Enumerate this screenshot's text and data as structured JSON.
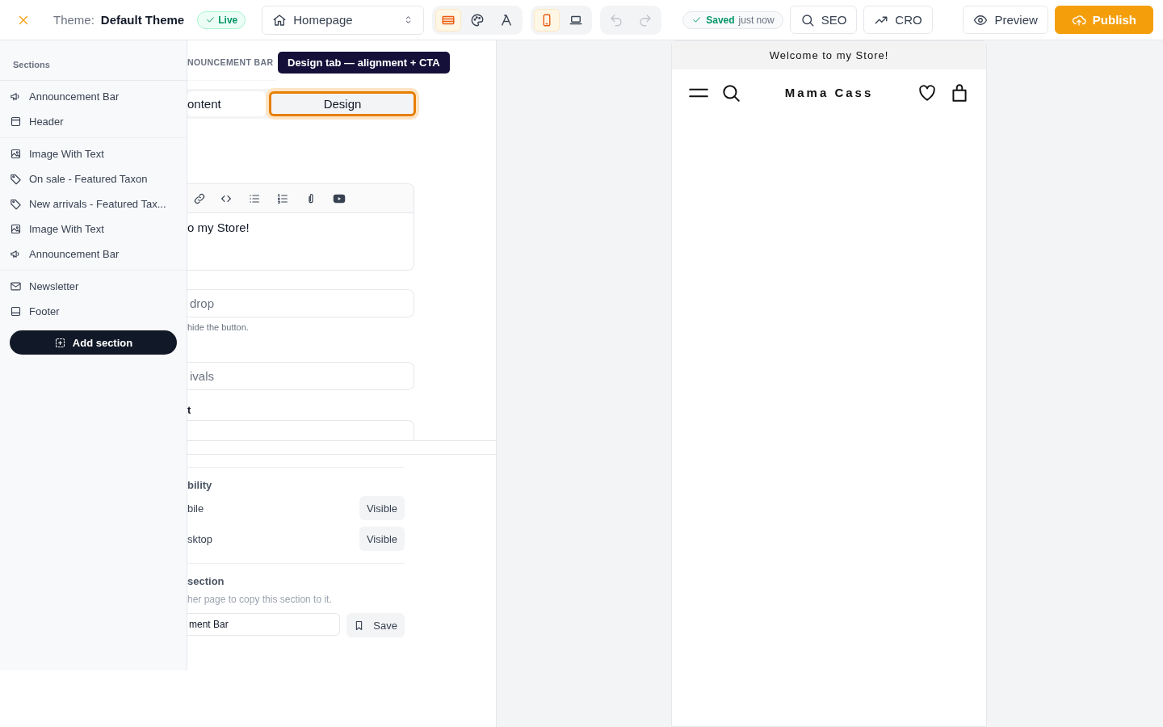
{
  "topbar": {
    "theme_label": "Theme:",
    "theme_name": "Default Theme",
    "status_badge": "Live",
    "page_select": "Homepage",
    "view_modes": [
      {
        "kind": "sections",
        "selected": true
      },
      {
        "kind": "palette",
        "selected": false
      },
      {
        "kind": "typography",
        "selected": false
      }
    ],
    "devices": [
      {
        "kind": "mobile",
        "selected": true
      },
      {
        "kind": "desktop",
        "selected": false
      }
    ],
    "history": [
      {
        "kind": "undo",
        "disabled": true
      },
      {
        "kind": "redo",
        "disabled": true
      }
    ],
    "save_status": {
      "state": "Saved",
      "time": "just now"
    },
    "tools": [
      {
        "kind": "search",
        "label": "SEO"
      },
      {
        "kind": "trend",
        "label": "CRO"
      }
    ],
    "preview_button": "Preview",
    "publish_button": "Publish"
  },
  "sidebar": {
    "title": "Sections",
    "groups": [
      [
        {
          "kind": "megaphone",
          "label": "Announcement Bar"
        },
        {
          "kind": "header",
          "label": "Header"
        }
      ],
      [
        {
          "kind": "image",
          "label": "Image With Text"
        },
        {
          "kind": "tag",
          "label": "On sale - Featured Taxon"
        },
        {
          "kind": "tag",
          "label": "New arrivals - Featured Tax..."
        },
        {
          "kind": "image",
          "label": "Image With Text"
        },
        {
          "kind": "megaphone",
          "label": "Announcement Bar"
        }
      ],
      [
        {
          "kind": "mail",
          "label": "Newsletter"
        },
        {
          "kind": "footer",
          "label": "Footer"
        }
      ]
    ],
    "add_button": "Add section"
  },
  "editor": {
    "section_title": "NOUNCEMENT BAR",
    "tabs": [
      {
        "label": "ontent",
        "selected": true,
        "highlighted": false
      },
      {
        "label": "Design",
        "selected": false,
        "highlighted": true
      }
    ],
    "tooltip": "Design tab — alignment + CTA",
    "toolbar": [
      {
        "kind": "link"
      },
      {
        "kind": "code"
      },
      {
        "kind": "bullets"
      },
      {
        "kind": "numbers"
      },
      {
        "kind": "attachment"
      },
      {
        "kind": "video"
      }
    ],
    "rich_text": "o my Store!",
    "fields": [
      {
        "placeholder": "drop",
        "hint": "hide the button."
      },
      {
        "placeholder": "ivals"
      },
      {
        "label": "t"
      }
    ],
    "visibility": {
      "title": "bility",
      "rows": [
        {
          "label": "bile",
          "value": "Visible"
        },
        {
          "label": "sktop",
          "value": "Visible"
        }
      ]
    },
    "copy": {
      "title": "section",
      "hint": "her page to copy this section to it.",
      "value": "ment Bar",
      "button": "Save"
    }
  },
  "preview": {
    "announcement": "Welcome to my Store!",
    "store_name": "Mama Cass"
  }
}
